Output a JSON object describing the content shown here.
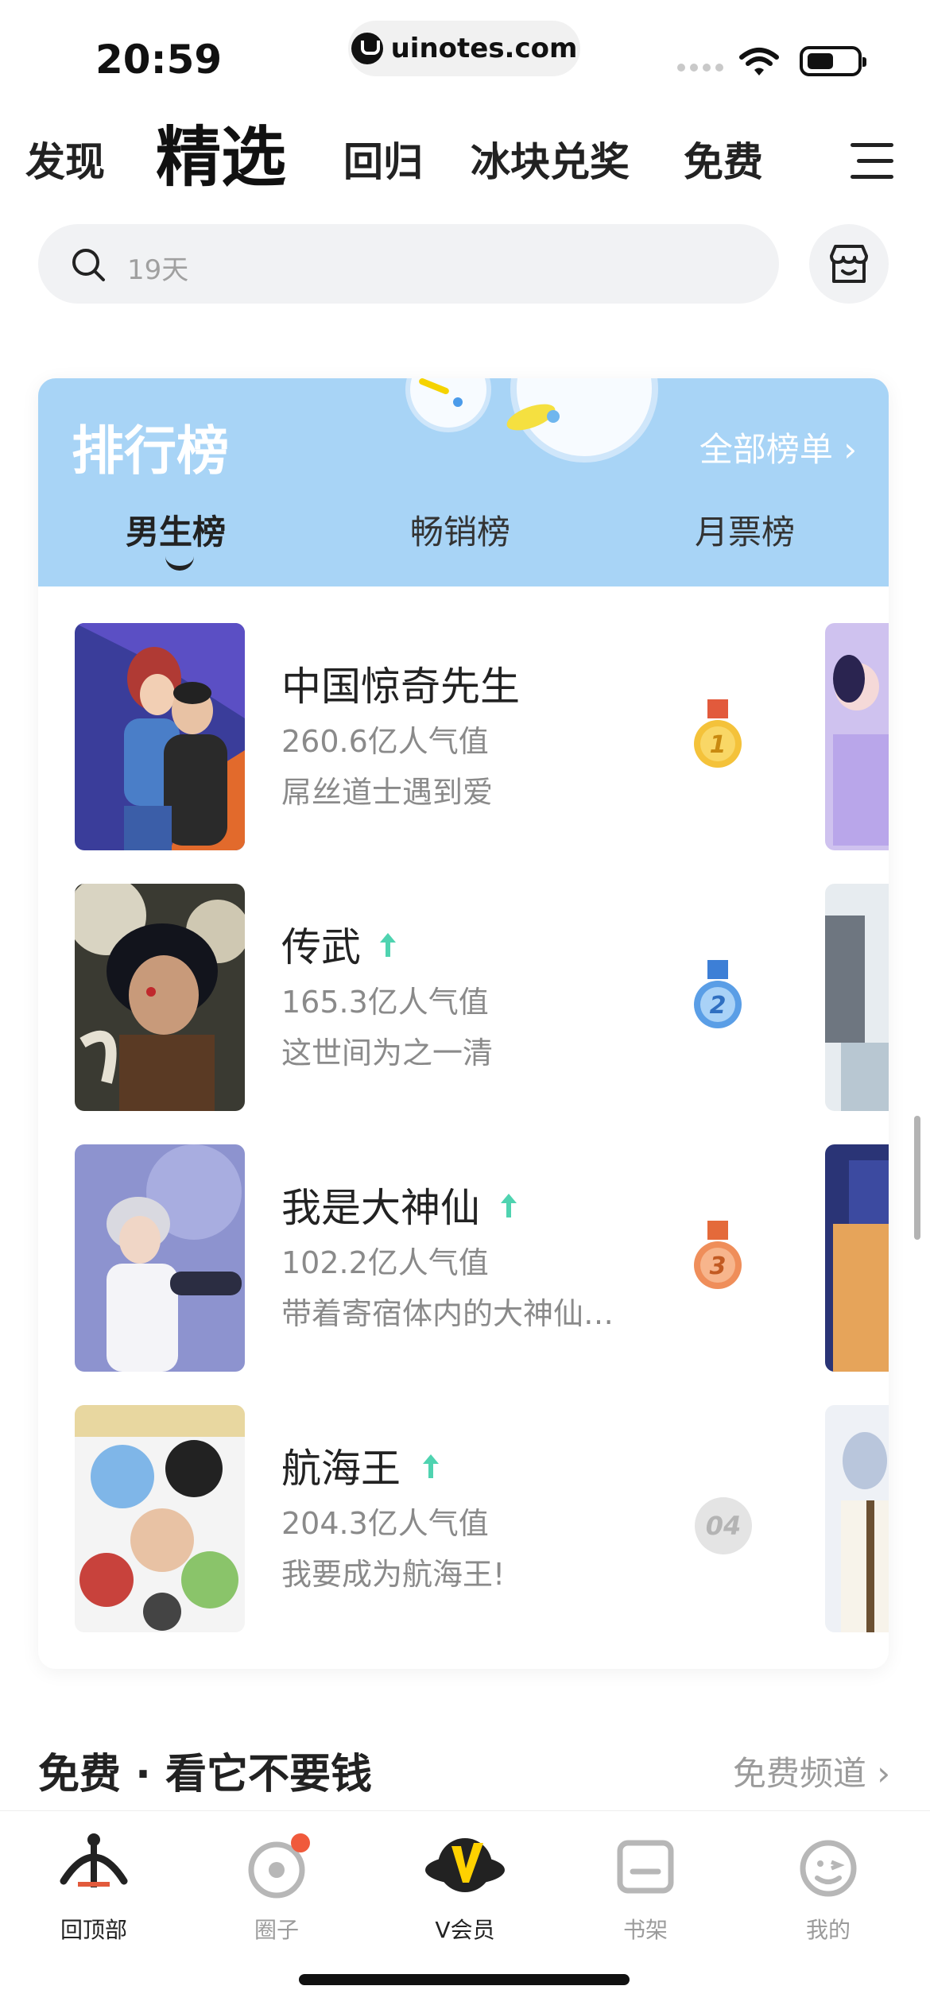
{
  "status_bar": {
    "time": "20:59",
    "url": "uinotes.com"
  },
  "top_tabs": [
    {
      "label": "发现"
    },
    {
      "label": "精选"
    },
    {
      "label": "回归"
    },
    {
      "label": "冰块兑奖"
    },
    {
      "label": "免费"
    }
  ],
  "search": {
    "placeholder": "19天"
  },
  "ranking": {
    "title": "排行榜",
    "all_lists": "全部榜单 ›",
    "tabs": [
      {
        "label": "男生榜"
      },
      {
        "label": "畅销榜"
      },
      {
        "label": "月票榜"
      }
    ],
    "items": [
      {
        "title": "中国惊奇先生",
        "popularity": "260.6亿人气值",
        "desc": "屌丝道士遇到爱",
        "rank": "1"
      },
      {
        "title": "传武",
        "popularity": "165.3亿人气值",
        "desc": "这世间为之一清",
        "rank": "2"
      },
      {
        "title": "我是大神仙",
        "popularity": "102.2亿人气值",
        "desc": "带着寄宿体内的大神仙…",
        "rank": "3"
      },
      {
        "title": "航海王",
        "popularity": "204.3亿人气值",
        "desc": "我要成为航海王!",
        "rank": "04"
      }
    ]
  },
  "free_section": {
    "title": "免费 · 看它不要钱",
    "link": "免费频道 ›"
  },
  "bottom_nav": [
    {
      "label": "回顶部"
    },
    {
      "label": "圈子"
    },
    {
      "label": "V会员"
    },
    {
      "label": "书架"
    },
    {
      "label": "我的"
    }
  ],
  "colors": {
    "ranking_header": "#a8d4f6",
    "rising_arrow": "#4fd3b0",
    "gold": "#f4c23a",
    "silver": "#5a9ee6",
    "bronze": "#ef8e5a",
    "badge_dot": "#f05a3c"
  }
}
